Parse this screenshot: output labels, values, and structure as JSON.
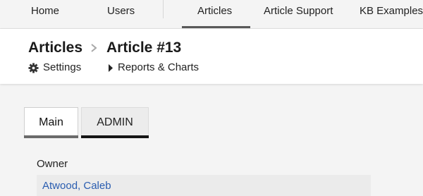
{
  "topnav": {
    "items": [
      {
        "label": "Home",
        "active": false
      },
      {
        "label": "Users",
        "active": false
      },
      {
        "label": "Articles",
        "active": true
      },
      {
        "label": "Article Support",
        "active": false
      },
      {
        "label": "KB Examples",
        "active": false
      }
    ]
  },
  "breadcrumb": {
    "parent": "Articles",
    "current": "Article #13",
    "separator_icon": "chevron-right-icon"
  },
  "subnav": {
    "settings_label": "Settings",
    "settings_icon": "gear-icon",
    "reports_label": "Reports & Charts",
    "reports_icon": "caret-right-icon"
  },
  "tabs": [
    {
      "label": "Main",
      "active": true
    },
    {
      "label": "ADMIN",
      "active": false
    }
  ],
  "owner": {
    "label": "Owner",
    "value": "Atwood, Caleb"
  },
  "colors": {
    "link": "#2a5db0",
    "active_tab_bar": "#6b6b6b",
    "inactive_tab_bar": "#151515"
  }
}
